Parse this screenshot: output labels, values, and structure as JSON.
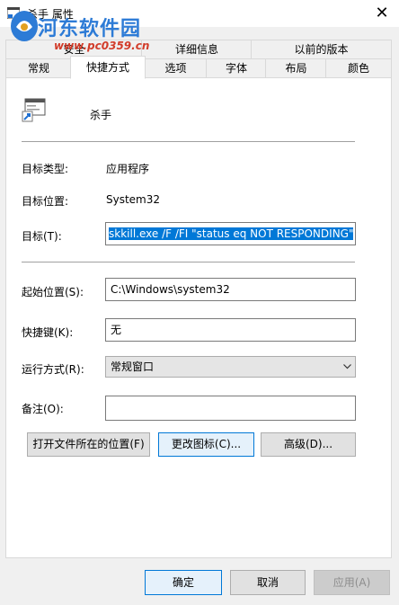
{
  "window": {
    "title": "杀手 属性",
    "close_glyph": "✕"
  },
  "watermark": {
    "name": "河东软件园",
    "url": "www.pc0359.cn"
  },
  "tabs_row1": [
    {
      "label": "安全"
    },
    {
      "label": "详细信息"
    },
    {
      "label": "以前的版本"
    }
  ],
  "tabs_row2": [
    {
      "label": "常规"
    },
    {
      "label": "快捷方式",
      "active": true
    },
    {
      "label": "选项"
    },
    {
      "label": "字体"
    },
    {
      "label": "布局"
    },
    {
      "label": "颜色"
    }
  ],
  "shortcut": {
    "name": "杀手",
    "icon": "shortcut-icon",
    "target_type_label": "目标类型:",
    "target_type_value": "应用程序",
    "target_location_label": "目标位置:",
    "target_location_value": "System32",
    "target_label": "目标(T):",
    "target_value": "skkill.exe /F /FI \"status eq NOT RESPONDING\"",
    "start_in_label": "起始位置(S):",
    "start_in_value": "C:\\Windows\\system32",
    "hotkey_label": "快捷键(K):",
    "hotkey_value": "无",
    "run_label": "运行方式(R):",
    "run_value": "常规窗口",
    "comment_label": "备注(O):",
    "comment_value": ""
  },
  "buttons": {
    "open_location": "打开文件所在的位置(F)",
    "change_icon": "更改图标(C)...",
    "advanced": "高级(D)..."
  },
  "footer": {
    "ok": "确定",
    "cancel": "取消",
    "apply": "应用(A)"
  },
  "colors": {
    "accent": "#0078d7",
    "watermark_blue": "#2d7bd6",
    "watermark_red": "#d23c2a"
  }
}
